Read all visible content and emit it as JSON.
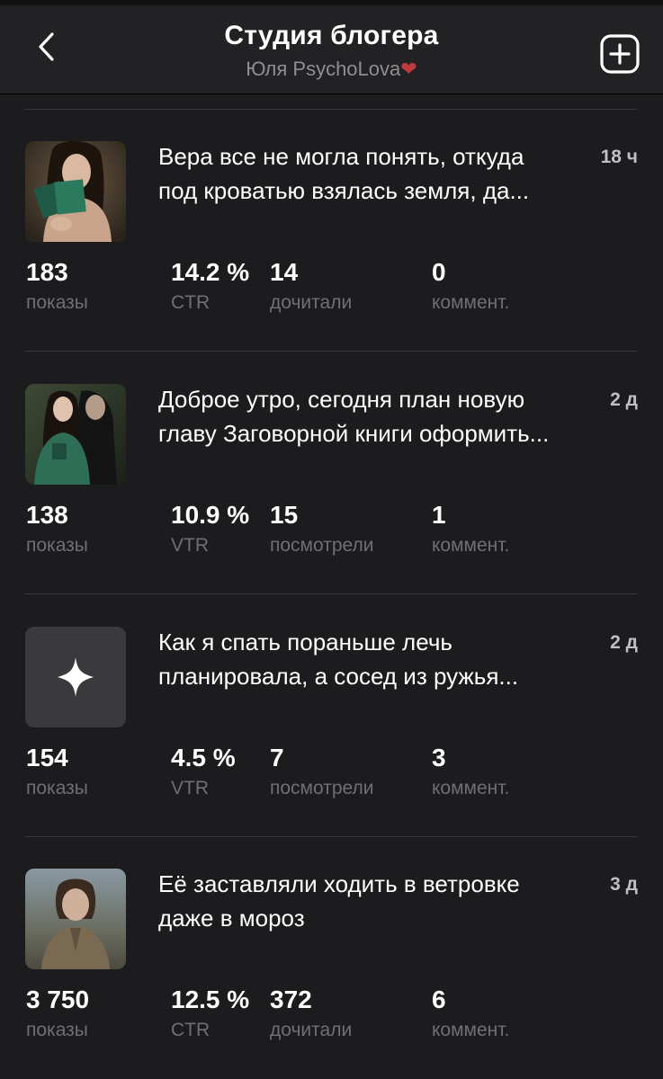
{
  "header": {
    "title": "Студия блогера",
    "subtitle": "Юля PsychoLova",
    "subtitle_emoji": "❤️"
  },
  "icons": {
    "back": "chevron-left-icon",
    "add": "plus-square-icon",
    "placeholder": "sparkle-icon"
  },
  "colors": {
    "background": "#1c1c1e",
    "header": "#222224",
    "muted": "#6f6f74",
    "heart": "#c0393b"
  },
  "posts": [
    {
      "title_line1": "Вера все не могла понять, откуда",
      "title_line2": "под кроватью взялась земля, да...",
      "time": "18 ч",
      "thumb": "woman-reading-book-photo",
      "stats": [
        {
          "value": "183",
          "label": "показы"
        },
        {
          "value": "14.2 %",
          "label": "CTR"
        },
        {
          "value": "14",
          "label": "дочитали"
        },
        {
          "value": "0",
          "label": "коммент."
        }
      ]
    },
    {
      "title_line1": "Доброе утро, сегодня план новую",
      "title_line2": "главу Заговорной книги оформить...",
      "time": "2 д",
      "thumb": "woman-with-old-woman-photo",
      "stats": [
        {
          "value": "138",
          "label": "показы"
        },
        {
          "value": "10.9 %",
          "label": "VTR"
        },
        {
          "value": "15",
          "label": "посмотрели"
        },
        {
          "value": "1",
          "label": "коммент."
        }
      ]
    },
    {
      "title_line1": "Как я спать пораньше лечь",
      "title_line2": "планировала, а сосед из ружья...",
      "time": "2 д",
      "thumb": "sparkle-placeholder",
      "stats": [
        {
          "value": "154",
          "label": "показы"
        },
        {
          "value": "4.5 %",
          "label": "VTR"
        },
        {
          "value": "7",
          "label": "посмотрели"
        },
        {
          "value": "3",
          "label": "коммент."
        }
      ]
    },
    {
      "title_line1": "Её заставляли ходить в ветровке",
      "title_line2": "даже в мороз",
      "time": "3 д",
      "thumb": "child-in-coat-photo",
      "stats": [
        {
          "value": "3 750",
          "label": "показы"
        },
        {
          "value": "12.5 %",
          "label": "CTR"
        },
        {
          "value": "372",
          "label": "дочитали"
        },
        {
          "value": "6",
          "label": "коммент."
        }
      ]
    }
  ]
}
